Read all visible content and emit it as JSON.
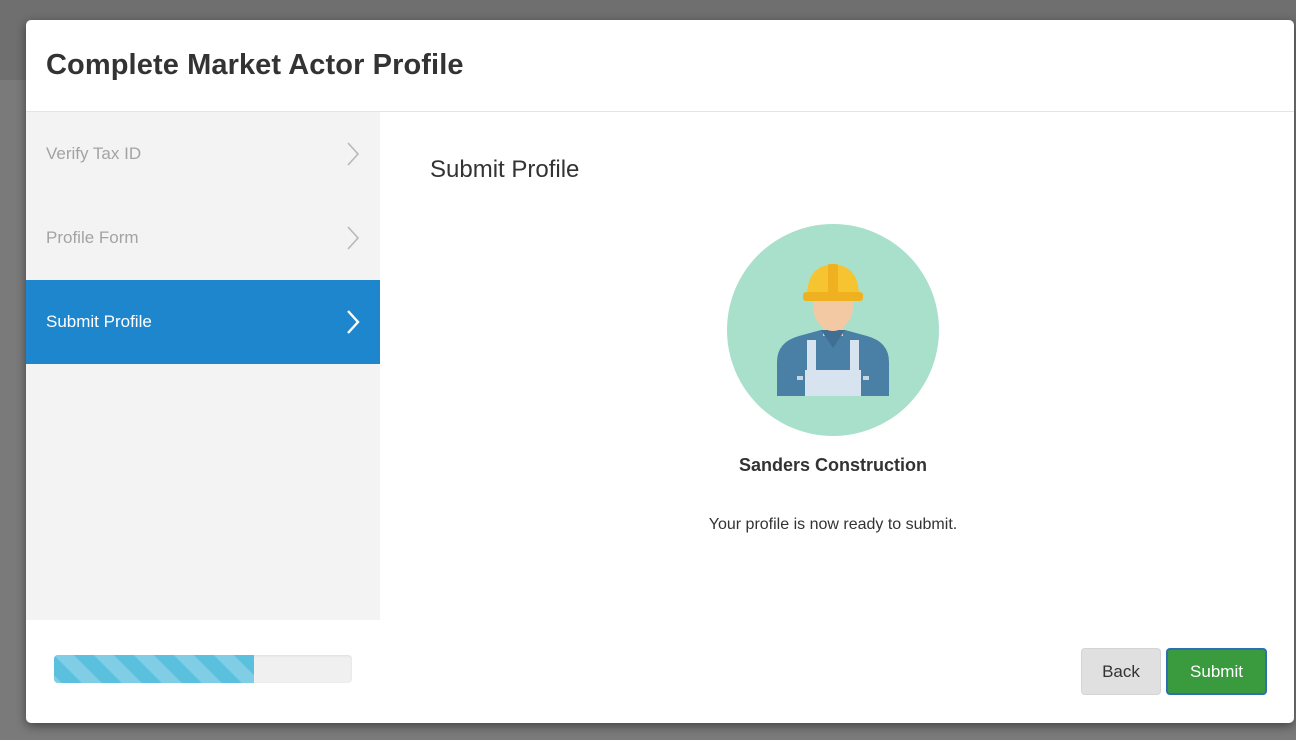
{
  "modal": {
    "title": "Complete Market Actor Profile"
  },
  "sidebar": {
    "steps": [
      {
        "label": "Verify Tax ID",
        "state": "completed"
      },
      {
        "label": "Profile Form",
        "state": "completed"
      },
      {
        "label": "Submit Profile",
        "state": "active"
      }
    ]
  },
  "main": {
    "section_title": "Submit Profile",
    "avatar_icon": "construction-worker-icon",
    "company_name": "Sanders Construction",
    "ready_text": "Your profile is now ready to submit."
  },
  "footer": {
    "progress_fraction": 0.67,
    "back_label": "Back",
    "submit_label": "Submit"
  },
  "colors": {
    "accent": "#1e86cc",
    "submit": "#3a9a3e",
    "progress": "#5bc0de",
    "avatar_bg": "#a8e0cc",
    "hard_hat": "#f7c431"
  }
}
